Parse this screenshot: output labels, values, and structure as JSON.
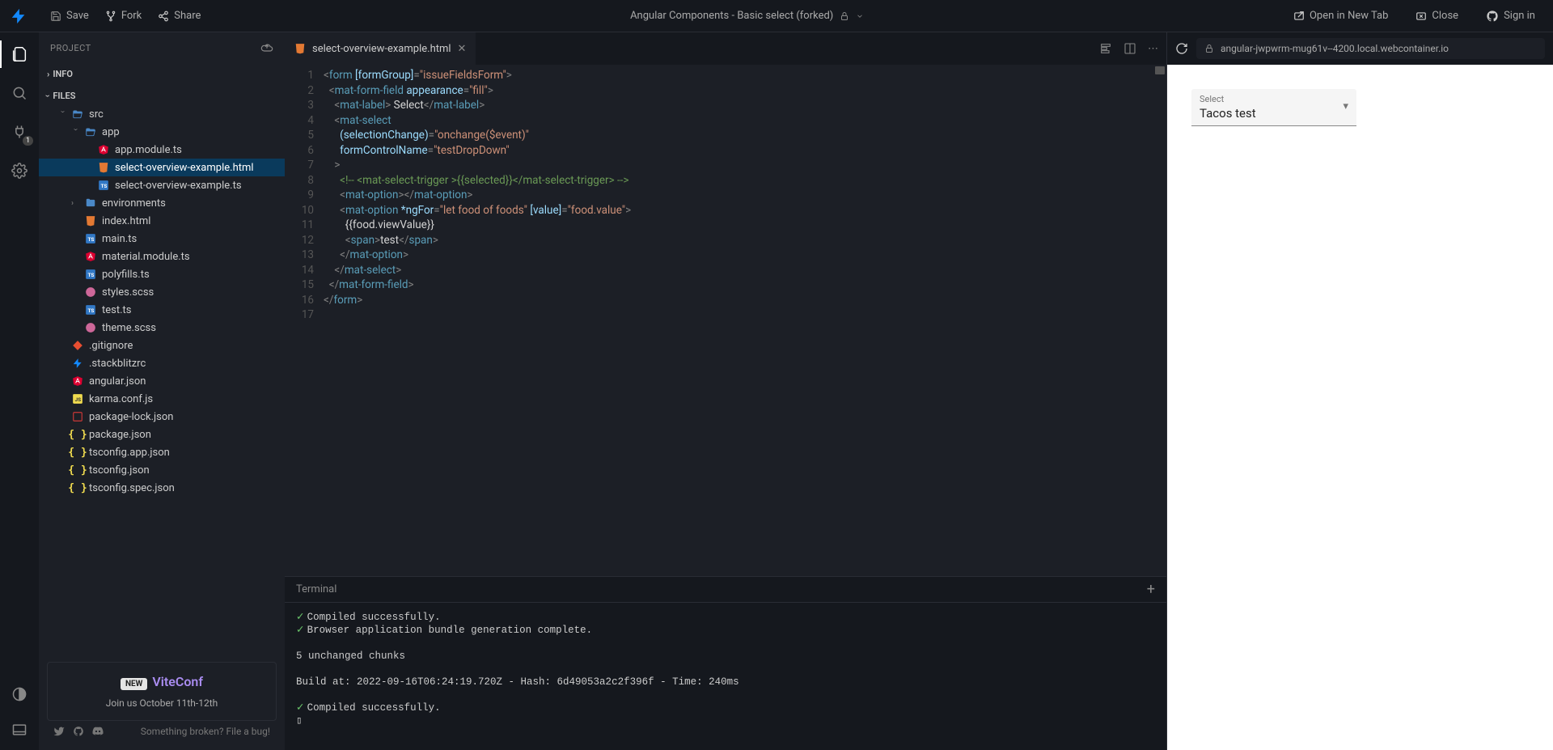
{
  "topbar": {
    "save": "Save",
    "fork": "Fork",
    "share": "Share",
    "title": "Angular Components - Basic select (forked)",
    "open_new_tab": "Open in New Tab",
    "close": "Close",
    "signin": "Sign in"
  },
  "activitybar": {
    "port_badge": "1"
  },
  "sidebar": {
    "header": "PROJECT",
    "sections": {
      "info": "INFO",
      "files": "FILES"
    },
    "tree": {
      "src": "src",
      "app": "app",
      "files_app": [
        {
          "name": "app.module.ts",
          "icon": "angular"
        },
        {
          "name": "select-overview-example.html",
          "icon": "html",
          "selected": true
        },
        {
          "name": "select-overview-example.ts",
          "icon": "ts"
        }
      ],
      "environments": "environments",
      "files_src": [
        {
          "name": "index.html",
          "icon": "html"
        },
        {
          "name": "main.ts",
          "icon": "ts"
        },
        {
          "name": "material.module.ts",
          "icon": "angular"
        },
        {
          "name": "polyfills.ts",
          "icon": "ts"
        },
        {
          "name": "styles.scss",
          "icon": "scss"
        },
        {
          "name": "test.ts",
          "icon": "ts"
        },
        {
          "name": "theme.scss",
          "icon": "scss"
        }
      ],
      "files_root": [
        {
          "name": ".gitignore",
          "icon": "git"
        },
        {
          "name": ".stackblitzrc",
          "icon": "bolt"
        },
        {
          "name": "angular.json",
          "icon": "angular"
        },
        {
          "name": "karma.conf.js",
          "icon": "js"
        },
        {
          "name": "package-lock.json",
          "icon": "pkg"
        },
        {
          "name": "package.json",
          "icon": "brace"
        },
        {
          "name": "tsconfig.app.json",
          "icon": "brace"
        },
        {
          "name": "tsconfig.json",
          "icon": "brace"
        },
        {
          "name": "tsconfig.spec.json",
          "icon": "brace"
        }
      ]
    },
    "promo": {
      "new": "NEW",
      "name": "ViteConf",
      "sub": "Join us October 11th-12th"
    },
    "footer_link": "Something broken? File a bug!"
  },
  "editor": {
    "tab_name": "select-overview-example.html",
    "line_numbers": [
      "1",
      "2",
      "3",
      "4",
      "5",
      "6",
      "7",
      "8",
      "9",
      "10",
      "11",
      "12",
      "13",
      "14",
      "15",
      "16",
      "17"
    ]
  },
  "terminal": {
    "label": "Terminal",
    "lines": [
      {
        "check": true,
        "text": "Compiled successfully."
      },
      {
        "check": true,
        "text": "Browser application bundle generation complete."
      },
      {
        "blank": true
      },
      {
        "text": "5 unchanged chunks"
      },
      {
        "blank": true
      },
      {
        "text": "Build at: 2022-09-16T06:24:19.720Z - Hash: 6d49053a2c2f396f - Time: 240ms"
      },
      {
        "blank": true
      },
      {
        "check": true,
        "text": "Compiled successfully."
      },
      {
        "text": "▯"
      }
    ]
  },
  "preview": {
    "url": "angular-jwpwrm-mug61v--4200.local.webcontainer.io",
    "select": {
      "label": "Select",
      "value": "Tacos test"
    }
  }
}
